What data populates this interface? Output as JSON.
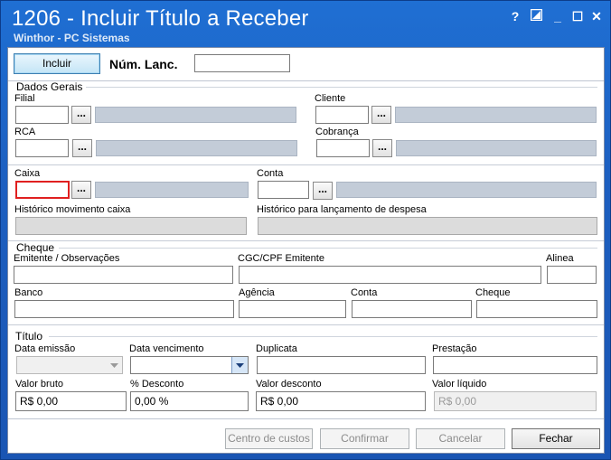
{
  "window": {
    "title": "1206 - Incluir Título a Receber",
    "subtitle": "Winthor - PC Sistemas",
    "controls": {
      "help": "?",
      "minimize": "_",
      "maximize": "☐",
      "close": "✕"
    }
  },
  "toolbar": {
    "incluir_label": "Incluir",
    "num_lanc_label": "Núm. Lanc.",
    "num_lanc_value": ""
  },
  "dados_gerais": {
    "title": "Dados Gerais",
    "filial_label": "Filial",
    "cliente_label": "Cliente",
    "rca_label": "RCA",
    "cobranca_label": "Cobrança",
    "lookup_button": "..."
  },
  "caixa": {
    "caixa_label": "Caixa",
    "conta_label": "Conta",
    "historico_caixa_label": "Histórico movimento caixa",
    "historico_despesa_label": "Histórico para lançamento de despesa"
  },
  "cheque": {
    "title": "Cheque",
    "emitente_label": "Emitente / Observações",
    "cgc_label": "CGC/CPF Emitente",
    "alinea_label": "Alinea",
    "banco_label": "Banco",
    "agencia_label": "Agência",
    "conta_label": "Conta",
    "cheque_label": "Cheque"
  },
  "titulo": {
    "title": "Título",
    "data_emissao_label": "Data emissão",
    "data_vencimento_label": "Data vencimento",
    "duplicata_label": "Duplicata",
    "prestacao_label": "Prestação",
    "valor_bruto_label": "Valor bruto",
    "valor_bruto_value": "R$ 0,00",
    "desconto_pct_label": "% Desconto",
    "desconto_pct_value": "0,00 %",
    "valor_desconto_label": "Valor desconto",
    "valor_desconto_value": "R$ 0,00",
    "valor_liquido_label": "Valor líquido",
    "valor_liquido_value": "R$ 0,00"
  },
  "footer": {
    "centro_custos_label": "Centro de custos",
    "confirmar_label": "Confirmar",
    "cancelar_label": "Cancelar",
    "fechar_label": "Fechar"
  }
}
